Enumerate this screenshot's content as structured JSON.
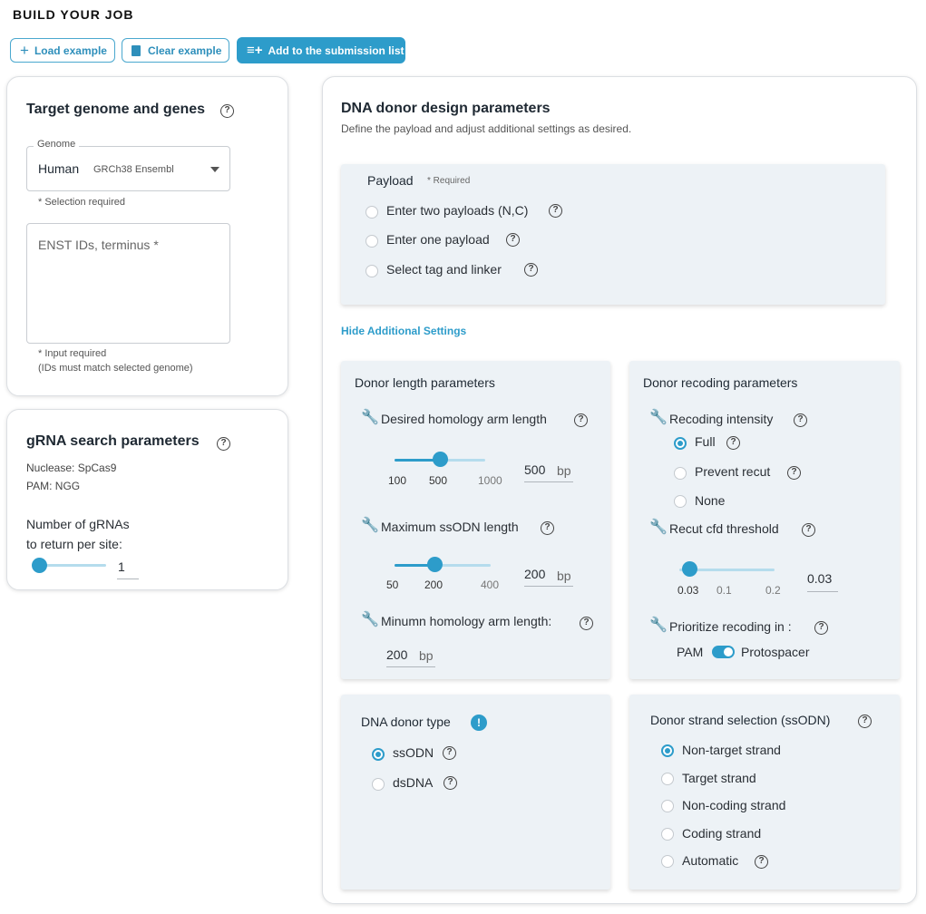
{
  "header": {
    "title": "BUILD YOUR JOB"
  },
  "toolbar": {
    "load_label": "Load example",
    "clear_label": "Clear example",
    "add_label": "Add to the submission list"
  },
  "target": {
    "title": "Target genome and genes",
    "genome_label": "Genome",
    "genome_value": "Human",
    "genome_sub": "GRCh38 Ensembl",
    "selection_required": "* Selection required",
    "ids_placeholder": "ENST IDs, terminus *",
    "input_required": "* Input required",
    "ids_note": "(IDs must match selected genome)"
  },
  "grna": {
    "title": "gRNA search parameters",
    "nuclease": "Nuclease: SpCas9",
    "pam": "PAM: NGG",
    "count_label_1": "Number of gRNAs",
    "count_label_2": "to return per site:",
    "count_value": "1"
  },
  "donor": {
    "title": "DNA donor design parameters",
    "subtitle": "Define the payload and adjust additional settings as desired.",
    "payload": {
      "label": "Payload",
      "required": "* Required",
      "options": [
        "Enter two payloads (N,C)",
        "Enter one payload",
        "Select tag and linker"
      ]
    },
    "hide_settings": "Hide Additional Settings",
    "length": {
      "title": "Donor length parameters",
      "homology_label": "Desired homology arm length",
      "homology_ticks": [
        "100",
        "500",
        "1000"
      ],
      "homology_value": "500",
      "homology_unit": "bp",
      "ssodn_label": "Maximum ssODN length",
      "ssodn_ticks": [
        "50",
        "200",
        "400"
      ],
      "ssodn_value": "200",
      "ssodn_unit": "bp",
      "min_label": "Minumn homology arm length:",
      "min_value": "200",
      "min_unit": "bp"
    },
    "recoding": {
      "title": "Donor recoding parameters",
      "intensity_label": "Recoding intensity",
      "intensity_options": [
        "Full",
        "Prevent recut",
        "None"
      ],
      "intensity_selected": "Full",
      "cfd_label": "Recut cfd threshold",
      "cfd_ticks": [
        "0.03",
        "0.1",
        "0.2"
      ],
      "cfd_value": "0.03",
      "prioritize_label": "Prioritize recoding in :",
      "toggle_left": "PAM",
      "toggle_right": "Protospacer"
    },
    "type": {
      "title": "DNA donor type",
      "options": [
        "ssODN",
        "dsDNA"
      ],
      "selected": "ssODN"
    },
    "strand": {
      "title": "Donor strand selection (ssODN)",
      "options": [
        "Non-target strand",
        "Target strand",
        "Non-coding strand",
        "Coding strand",
        "Automatic"
      ],
      "selected": "Non-target strand"
    }
  },
  "colors": {
    "accent": "#2d9cca",
    "panel": "#edf2f6"
  },
  "icons": [
    "plus-icon",
    "trash-icon",
    "playlist-add-icon",
    "help-icon",
    "wrench-icon",
    "caret-down-icon",
    "info-alert-icon"
  ]
}
